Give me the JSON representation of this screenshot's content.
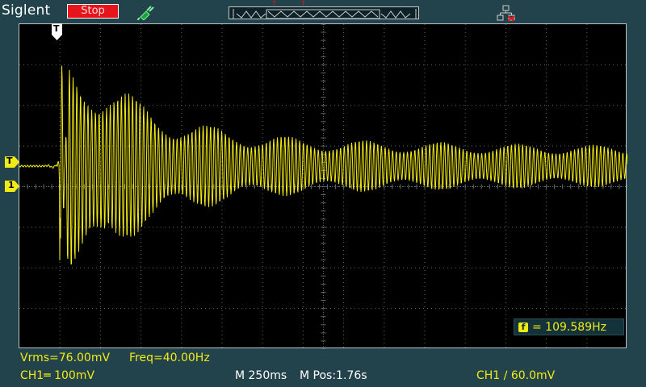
{
  "header": {
    "brand": "Siglent",
    "run_status": "Stop",
    "buffer_trigger_markers": [
      "T",
      "T"
    ]
  },
  "screen": {
    "trigger_position_marker": "T",
    "trigger_level_marker": "T",
    "channel_marker": "1",
    "frequency_badge": "f",
    "frequency_reading": "= 109.589Hz"
  },
  "measurements": {
    "vrms": "Vrms=76.00mV",
    "freq": "Freq=40.00Hz"
  },
  "status_bar": {
    "ch1_scale": "CH1═ 100mV",
    "timebase": "M 250ms",
    "position": "M Pos:1.76s",
    "trigger": "CH1 ∕ 60.0mV"
  },
  "colors": {
    "background": "#22434b",
    "trace": "#f2ea14",
    "grid": "#5f6d70",
    "stop": "#e8141b"
  },
  "chart_data": {
    "type": "line",
    "series": [
      {
        "values": [
          [
            0,
            0.0
          ],
          [
            0.6,
            0.0
          ],
          [
            0.8,
            0.05
          ],
          [
            0.98,
            0.25
          ],
          [
            1.0,
            6.3
          ],
          [
            1.02,
            -7.1
          ],
          [
            1.2,
            5.3
          ],
          [
            2,
            4.7
          ],
          [
            3,
            3.2
          ],
          [
            4,
            2.3
          ],
          [
            5,
            1.9
          ],
          [
            6,
            1.6
          ],
          [
            7,
            1.4
          ],
          [
            8,
            1.3
          ],
          [
            9,
            1.25
          ],
          [
            10,
            1.2
          ],
          [
            11,
            1.15
          ],
          [
            12,
            1.1
          ],
          [
            13,
            1.1
          ],
          [
            14,
            1.05
          ],
          [
            15,
            1.05
          ]
        ]
      }
    ],
    "x_divisions": 15,
    "y_divisions": 8,
    "grid": true,
    "frequency_hz": 109.589
  }
}
